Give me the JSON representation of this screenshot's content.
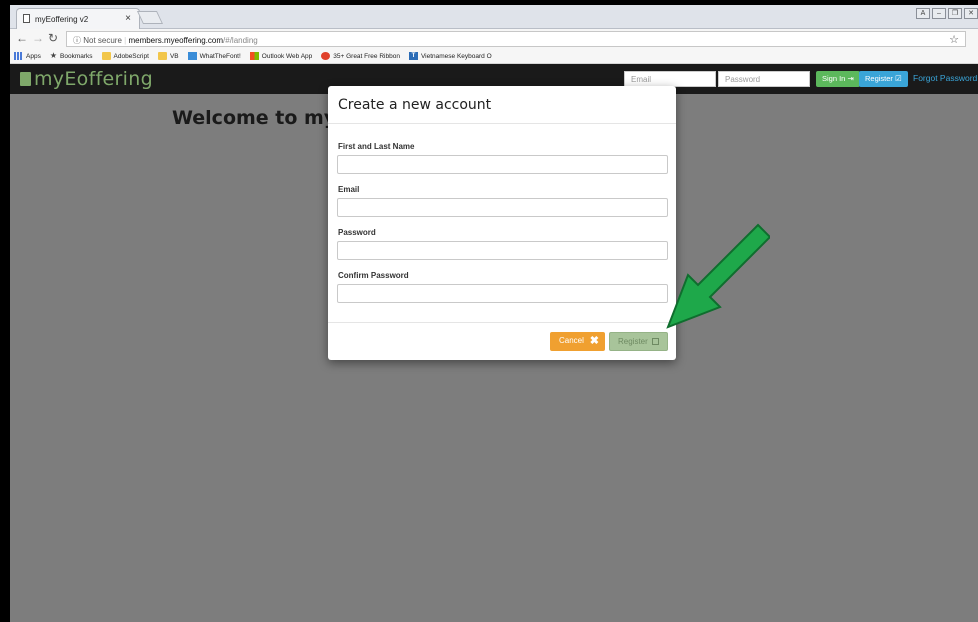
{
  "browser": {
    "tab_title": "myEoffering v2",
    "tab_close": "×",
    "url_security": "ⓘ Not secure",
    "url_host": "members.myeoffering.com",
    "url_path": "/#/landing",
    "window_controls": [
      "A",
      "–",
      "❐",
      "✕"
    ]
  },
  "bookmarks": [
    {
      "label": "Apps",
      "icon": "apps-icon"
    },
    {
      "label": "Bookmarks",
      "icon": "star-icon"
    },
    {
      "label": "AdobeScript",
      "icon": "folder-icon"
    },
    {
      "label": "VB",
      "icon": "folder-icon"
    },
    {
      "label": "WhatTheFont!",
      "icon": "whatthefont-icon"
    },
    {
      "label": "Outlook Web App",
      "icon": "outlook-icon"
    },
    {
      "label": "35+ Great Free Ribbon",
      "icon": "site-icon"
    },
    {
      "label": "Vietnamese Keyboard O",
      "icon": "keyboard-icon"
    }
  ],
  "navbar": {
    "logo": "myEoffering",
    "email_placeholder": "Email",
    "password_placeholder": "Password",
    "signin_label": "Sign In",
    "register_label": "Register",
    "forgot_label": "Forgot Password"
  },
  "page": {
    "welcome": "Welcome to my"
  },
  "modal": {
    "title": "Create a new account",
    "fields": [
      {
        "label": "First and Last Name"
      },
      {
        "label": "Email"
      },
      {
        "label": "Password"
      },
      {
        "label": "Confirm Password"
      }
    ],
    "cancel_label": "Cancel",
    "register_label": "Register"
  },
  "colors": {
    "arrow": "#1ea84a",
    "signin": "#5cb85c",
    "register": "#3aa5d8",
    "cancel": "#f0a030"
  }
}
